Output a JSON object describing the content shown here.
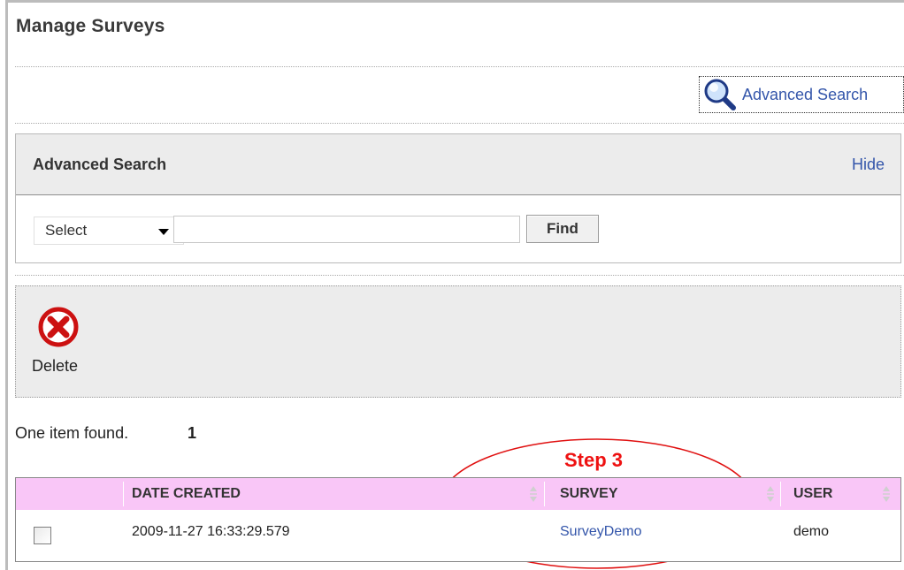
{
  "page": {
    "title": "Manage Surveys"
  },
  "advanced_search_link": {
    "label": "Advanced Search",
    "icon": "magnifier-icon"
  },
  "advanced_search_panel": {
    "title": "Advanced Search",
    "hide_label": "Hide",
    "select_value": "Select",
    "search_value": "",
    "find_label": "Find"
  },
  "toolbar": {
    "delete_label": "Delete",
    "delete_icon": "delete-x-icon"
  },
  "results": {
    "summary": "One item found.",
    "page_number": "1"
  },
  "annotation": {
    "label": "Step 3",
    "color": "#ee1111"
  },
  "table": {
    "header_bg": "#f9c6f7",
    "columns": [
      "DATE CREATED",
      "SURVEY",
      "USER"
    ],
    "rows": [
      {
        "date_created": "2009-11-27 16:33:29.579",
        "survey": "SurveyDemo",
        "user": "demo"
      }
    ]
  }
}
